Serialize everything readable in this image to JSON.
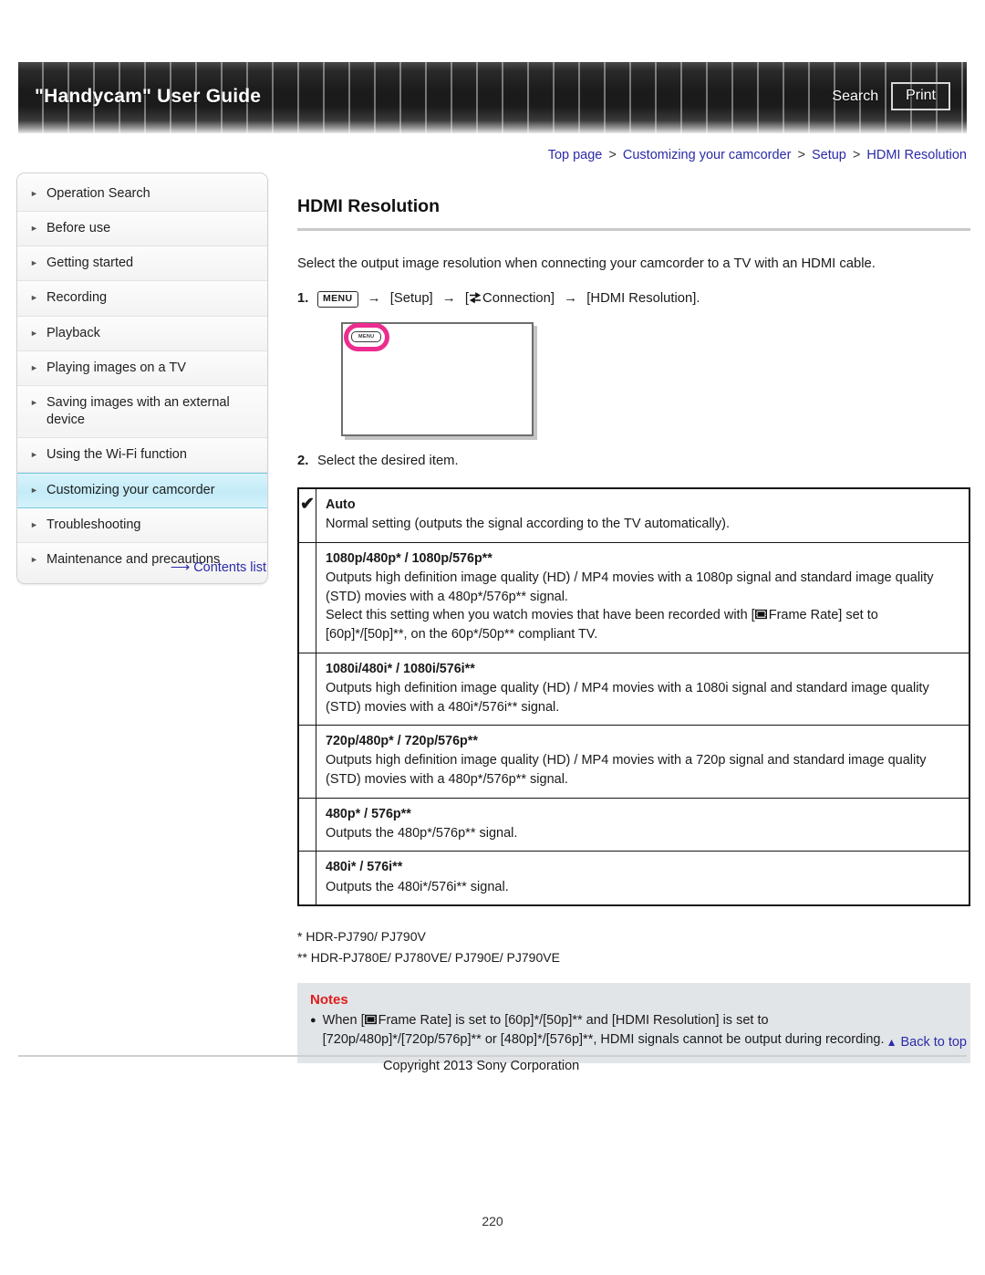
{
  "header": {
    "title": "\"Handycam\" User Guide",
    "search_label": "Search",
    "print_label": "Print"
  },
  "breadcrumb": {
    "items": [
      "Top page",
      "Customizing your camcorder",
      "Setup",
      "HDMI Resolution"
    ],
    "separator": ">"
  },
  "sidebar": {
    "items": [
      {
        "label": "Operation Search",
        "active": false
      },
      {
        "label": "Before use",
        "active": false
      },
      {
        "label": "Getting started",
        "active": false
      },
      {
        "label": "Recording",
        "active": false
      },
      {
        "label": "Playback",
        "active": false
      },
      {
        "label": "Playing images on a TV",
        "active": false
      },
      {
        "label": "Saving images with an external device",
        "active": false
      },
      {
        "label": "Using the Wi-Fi function",
        "active": false
      },
      {
        "label": "Customizing your camcorder",
        "active": true
      },
      {
        "label": "Troubleshooting",
        "active": false
      },
      {
        "label": "Maintenance and precautions",
        "active": false
      }
    ],
    "contents_list_label": "Contents list"
  },
  "main": {
    "title": "HDMI Resolution",
    "intro": "Select the output image resolution when connecting your camcorder to a TV with an HDMI cable.",
    "step1": {
      "number": "1.",
      "menu_chip": "MENU",
      "arrow": "→",
      "part_setup": "[Setup]",
      "part_connection_open": "[",
      "part_connection_label": "Connection]",
      "part_hdmi": "[HDMI Resolution]."
    },
    "illustration": {
      "menu_chip": "MENU"
    },
    "step2": {
      "number": "2.",
      "text": "Select the desired item."
    }
  },
  "options_table": {
    "rows": [
      {
        "checked": true,
        "check_glyph": "✔",
        "name": "Auto",
        "description": "Normal setting (outputs the signal according to the TV automatically)."
      },
      {
        "checked": false,
        "check_glyph": "",
        "name": "1080p/480p* / 1080p/576p**",
        "description_lines": [
          "Outputs high definition image quality (HD) / MP4 movies with a 1080p signal and standard image quality (STD) movies with a 480p*/576p** signal.",
          "Select this setting when you watch movies that have been recorded with [�Frame Rate] set to [60p]*/[50p]**, on the 60p*/50p** compliant TV."
        ],
        "description_pre": "Outputs high definition image quality (HD) / MP4 movies with a 1080p signal and standard image quality (STD) movies with a 480p*/576p** signal.",
        "frame_rate_pre": "Select this setting when you watch movies that have been recorded with [",
        "frame_rate_label": "Frame Rate] set to",
        "frame_rate_post": "[60p]*/[50p]**, on the 60p*/50p** compliant TV."
      },
      {
        "checked": false,
        "check_glyph": "",
        "name": "1080i/480i* / 1080i/576i**",
        "description": "Outputs high definition image quality (HD) / MP4 movies with a 1080i signal and standard image quality (STD) movies with a 480i*/576i** signal."
      },
      {
        "checked": false,
        "check_glyph": "",
        "name": "720p/480p* / 720p/576p**",
        "description": "Outputs high definition image quality (HD) / MP4 movies with a 720p signal and standard image quality (STD) movies with a 480p*/576p** signal."
      },
      {
        "checked": false,
        "check_glyph": "",
        "name": "480p* / 576p**",
        "description": "Outputs the 480p*/576p** signal."
      },
      {
        "checked": false,
        "check_glyph": "",
        "name": "480i* / 576i**",
        "description": "Outputs the 480i*/576i** signal."
      }
    ]
  },
  "footnotes": {
    "single_star": "* HDR-PJ790/ PJ790V",
    "double_star": "** HDR-PJ780E/ PJ780VE/ PJ790E/ PJ790VE"
  },
  "notes": {
    "title": "Notes",
    "bullet": "●",
    "item_pre": "When [",
    "item_label": "Frame Rate] is set to [60p]*/[50p]** and [HDMI Resolution] is set to",
    "item_post": "[720p/480p]*/[720p/576p]** or [480p]*/[576p]**, HDMI signals cannot be output during recording."
  },
  "footer": {
    "back_to_top": "Back to top",
    "back_to_top_glyph": "▲",
    "copyright": "Copyright 2013 Sony Corporation",
    "page_number": "220"
  },
  "colors": {
    "link": "#2b2ba8",
    "notes_red": "#e01b1b",
    "notes_bg": "#e2e5e8",
    "active_nav": "#c4ecf8",
    "highlight_magenta": "#ec2d8f"
  }
}
